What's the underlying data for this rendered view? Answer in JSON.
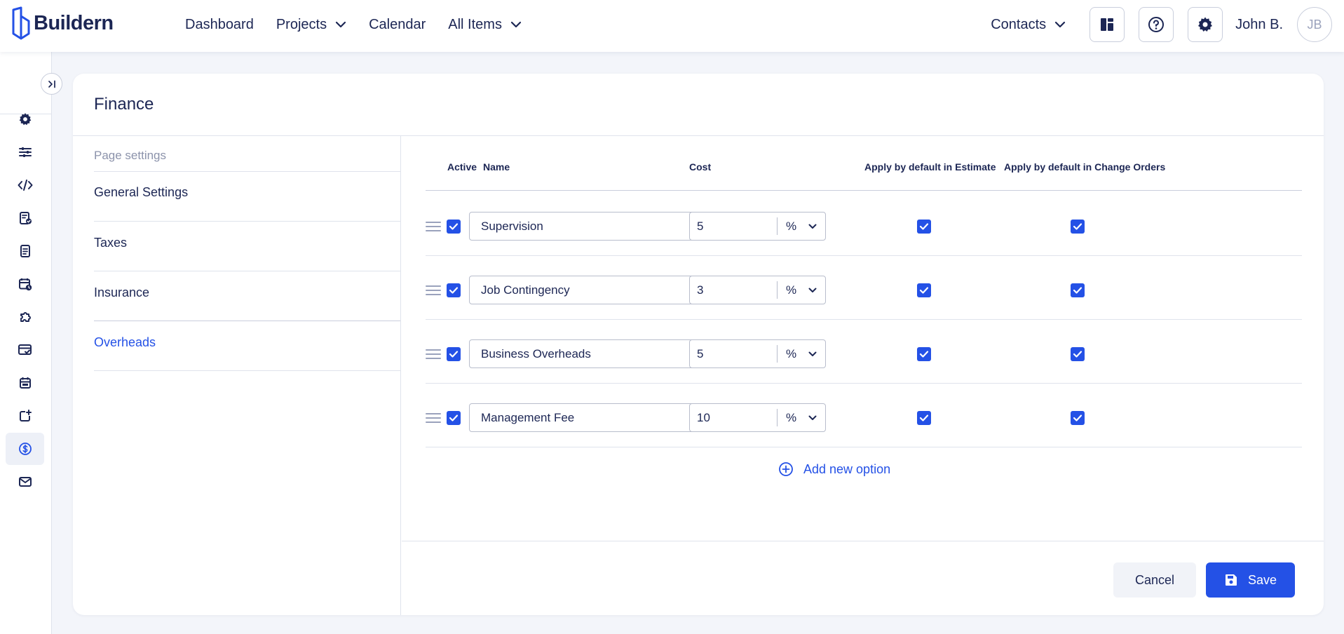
{
  "brand": {
    "name": "Buildern",
    "color": "#2451e6",
    "text_color": "#1c2654"
  },
  "nav": {
    "items": [
      {
        "label": "Dashboard",
        "dropdown": false
      },
      {
        "label": "Projects",
        "dropdown": true
      },
      {
        "label": "Calendar",
        "dropdown": false
      },
      {
        "label": "All Items",
        "dropdown": true
      }
    ],
    "contacts_label": "Contacts",
    "user_name": "John B.",
    "user_initials": "JB"
  },
  "rail": {
    "icons": [
      "gear-icon",
      "sliders-icon",
      "code-icon",
      "document-check-icon",
      "document-icon",
      "calendar-clock-icon",
      "puzzle-icon",
      "card-check-icon",
      "calendar-icon",
      "add-task-icon",
      "dollar-icon",
      "mail-icon"
    ],
    "active_index": 10
  },
  "page": {
    "title": "Finance"
  },
  "settings_nav": {
    "header": "Page settings",
    "items": [
      "General Settings",
      "Taxes",
      "Insurance",
      "Overheads"
    ],
    "active": "Overheads"
  },
  "table": {
    "headers": {
      "active": "Active",
      "name": "Name",
      "cost": "Cost",
      "apply_estimate": "Apply by default in Estimate",
      "apply_change_orders": "Apply by default in Change Orders"
    },
    "rows": [
      {
        "active": true,
        "name": "Supervision",
        "cost": "5",
        "unit": "%",
        "apply_estimate": true,
        "apply_change_orders": true
      },
      {
        "active": true,
        "name": "Job Contingency",
        "cost": "3",
        "unit": "%",
        "apply_estimate": true,
        "apply_change_orders": true
      },
      {
        "active": true,
        "name": "Business Overheads",
        "cost": "5",
        "unit": "%",
        "apply_estimate": true,
        "apply_change_orders": true
      },
      {
        "active": true,
        "name": "Management Fee",
        "cost": "10",
        "unit": "%",
        "apply_estimate": true,
        "apply_change_orders": true
      }
    ],
    "add_option_label": "Add new option"
  },
  "footer": {
    "cancel_label": "Cancel",
    "save_label": "Save"
  }
}
